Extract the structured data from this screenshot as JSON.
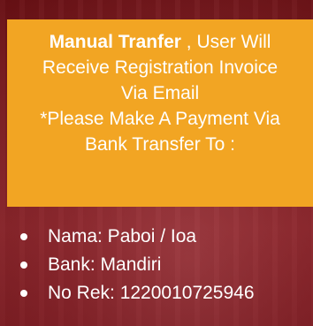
{
  "notice": {
    "title_bold": "Manual Tranfer",
    "title_rest": " , User Will",
    "line2": "Receive Registration Invoice",
    "line3": "Via Email",
    "line4": "*Please Make A Payment Via",
    "line5": "Bank Transfer To :"
  },
  "bank": {
    "items": [
      "Nama: Paboi / Ioa",
      "Bank: Mandiri",
      "No Rek: 1220010725946"
    ]
  },
  "colors": {
    "notice_bg": "#f2a523",
    "page_bg": "#7a1418",
    "text": "#ffffff"
  }
}
